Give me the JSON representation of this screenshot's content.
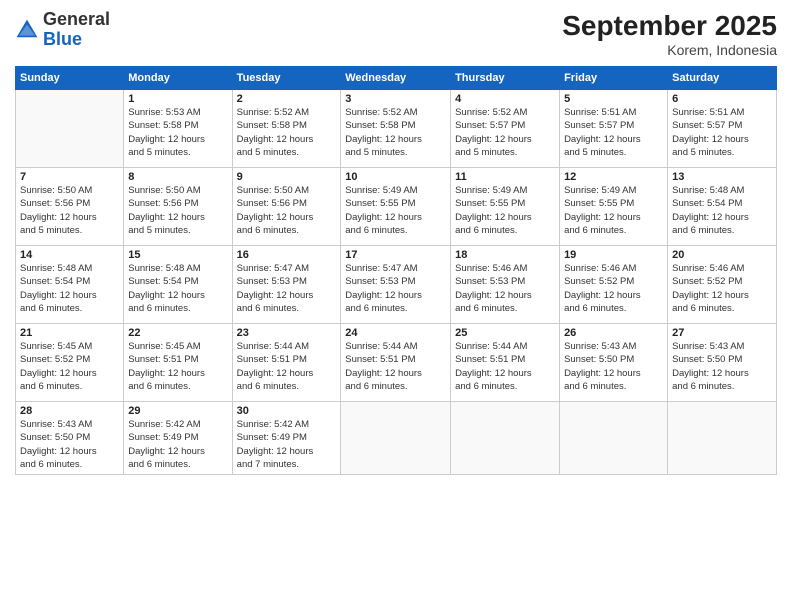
{
  "header": {
    "logo": {
      "general": "General",
      "blue": "Blue"
    },
    "title": "September 2025",
    "location": "Korem, Indonesia"
  },
  "days_of_week": [
    "Sunday",
    "Monday",
    "Tuesday",
    "Wednesday",
    "Thursday",
    "Friday",
    "Saturday"
  ],
  "weeks": [
    [
      {
        "day": "",
        "info": ""
      },
      {
        "day": "1",
        "info": "Sunrise: 5:53 AM\nSunset: 5:58 PM\nDaylight: 12 hours\nand 5 minutes."
      },
      {
        "day": "2",
        "info": "Sunrise: 5:52 AM\nSunset: 5:58 PM\nDaylight: 12 hours\nand 5 minutes."
      },
      {
        "day": "3",
        "info": "Sunrise: 5:52 AM\nSunset: 5:58 PM\nDaylight: 12 hours\nand 5 minutes."
      },
      {
        "day": "4",
        "info": "Sunrise: 5:52 AM\nSunset: 5:57 PM\nDaylight: 12 hours\nand 5 minutes."
      },
      {
        "day": "5",
        "info": "Sunrise: 5:51 AM\nSunset: 5:57 PM\nDaylight: 12 hours\nand 5 minutes."
      },
      {
        "day": "6",
        "info": "Sunrise: 5:51 AM\nSunset: 5:57 PM\nDaylight: 12 hours\nand 5 minutes."
      }
    ],
    [
      {
        "day": "7",
        "info": "Sunrise: 5:50 AM\nSunset: 5:56 PM\nDaylight: 12 hours\nand 5 minutes."
      },
      {
        "day": "8",
        "info": "Sunrise: 5:50 AM\nSunset: 5:56 PM\nDaylight: 12 hours\nand 5 minutes."
      },
      {
        "day": "9",
        "info": "Sunrise: 5:50 AM\nSunset: 5:56 PM\nDaylight: 12 hours\nand 6 minutes."
      },
      {
        "day": "10",
        "info": "Sunrise: 5:49 AM\nSunset: 5:55 PM\nDaylight: 12 hours\nand 6 minutes."
      },
      {
        "day": "11",
        "info": "Sunrise: 5:49 AM\nSunset: 5:55 PM\nDaylight: 12 hours\nand 6 minutes."
      },
      {
        "day": "12",
        "info": "Sunrise: 5:49 AM\nSunset: 5:55 PM\nDaylight: 12 hours\nand 6 minutes."
      },
      {
        "day": "13",
        "info": "Sunrise: 5:48 AM\nSunset: 5:54 PM\nDaylight: 12 hours\nand 6 minutes."
      }
    ],
    [
      {
        "day": "14",
        "info": "Sunrise: 5:48 AM\nSunset: 5:54 PM\nDaylight: 12 hours\nand 6 minutes."
      },
      {
        "day": "15",
        "info": "Sunrise: 5:48 AM\nSunset: 5:54 PM\nDaylight: 12 hours\nand 6 minutes."
      },
      {
        "day": "16",
        "info": "Sunrise: 5:47 AM\nSunset: 5:53 PM\nDaylight: 12 hours\nand 6 minutes."
      },
      {
        "day": "17",
        "info": "Sunrise: 5:47 AM\nSunset: 5:53 PM\nDaylight: 12 hours\nand 6 minutes."
      },
      {
        "day": "18",
        "info": "Sunrise: 5:46 AM\nSunset: 5:53 PM\nDaylight: 12 hours\nand 6 minutes."
      },
      {
        "day": "19",
        "info": "Sunrise: 5:46 AM\nSunset: 5:52 PM\nDaylight: 12 hours\nand 6 minutes."
      },
      {
        "day": "20",
        "info": "Sunrise: 5:46 AM\nSunset: 5:52 PM\nDaylight: 12 hours\nand 6 minutes."
      }
    ],
    [
      {
        "day": "21",
        "info": "Sunrise: 5:45 AM\nSunset: 5:52 PM\nDaylight: 12 hours\nand 6 minutes."
      },
      {
        "day": "22",
        "info": "Sunrise: 5:45 AM\nSunset: 5:51 PM\nDaylight: 12 hours\nand 6 minutes."
      },
      {
        "day": "23",
        "info": "Sunrise: 5:44 AM\nSunset: 5:51 PM\nDaylight: 12 hours\nand 6 minutes."
      },
      {
        "day": "24",
        "info": "Sunrise: 5:44 AM\nSunset: 5:51 PM\nDaylight: 12 hours\nand 6 minutes."
      },
      {
        "day": "25",
        "info": "Sunrise: 5:44 AM\nSunset: 5:51 PM\nDaylight: 12 hours\nand 6 minutes."
      },
      {
        "day": "26",
        "info": "Sunrise: 5:43 AM\nSunset: 5:50 PM\nDaylight: 12 hours\nand 6 minutes."
      },
      {
        "day": "27",
        "info": "Sunrise: 5:43 AM\nSunset: 5:50 PM\nDaylight: 12 hours\nand 6 minutes."
      }
    ],
    [
      {
        "day": "28",
        "info": "Sunrise: 5:43 AM\nSunset: 5:50 PM\nDaylight: 12 hours\nand 6 minutes."
      },
      {
        "day": "29",
        "info": "Sunrise: 5:42 AM\nSunset: 5:49 PM\nDaylight: 12 hours\nand 6 minutes."
      },
      {
        "day": "30",
        "info": "Sunrise: 5:42 AM\nSunset: 5:49 PM\nDaylight: 12 hours\nand 7 minutes."
      },
      {
        "day": "",
        "info": ""
      },
      {
        "day": "",
        "info": ""
      },
      {
        "day": "",
        "info": ""
      },
      {
        "day": "",
        "info": ""
      }
    ]
  ]
}
